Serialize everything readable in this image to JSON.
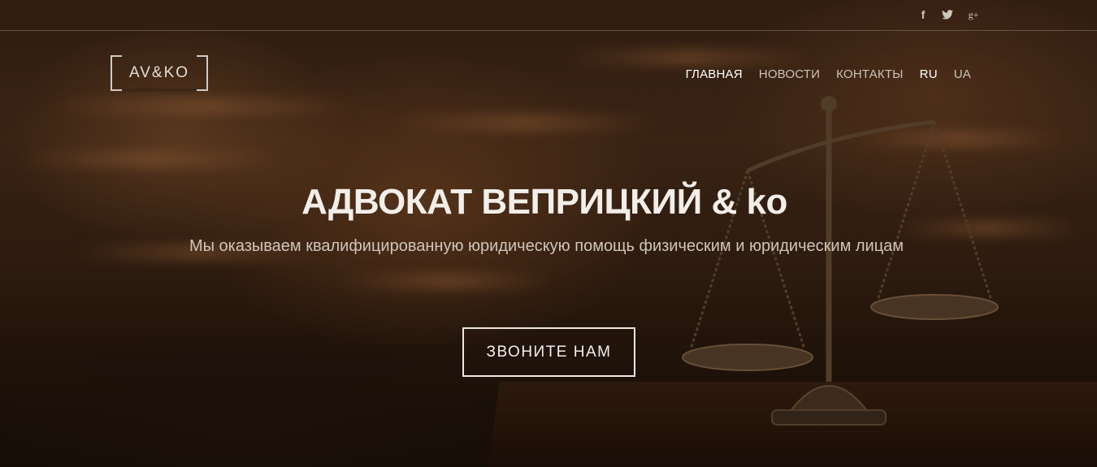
{
  "social": {
    "facebook_icon": "f",
    "twitter_icon": "🐦",
    "googleplus_icon": "g+"
  },
  "logo": {
    "text": "AV&KO"
  },
  "nav": {
    "items": [
      {
        "label": "ГЛАВНАЯ",
        "active": true
      },
      {
        "label": "НОВОСТИ",
        "active": false
      },
      {
        "label": "КОНТАКТЫ",
        "active": false
      }
    ],
    "languages": [
      {
        "label": "RU",
        "active": true
      },
      {
        "label": "UA",
        "active": false
      }
    ]
  },
  "hero": {
    "title": "АДВОКАТ ВЕПРИЦКИЙ & ko",
    "subtitle": "Мы оказываем квалифицированную юридическую помощь физическим и юридическим лицам",
    "cta_label": "ЗВОНИТЕ НАМ"
  },
  "colors": {
    "text_primary": "#f2eeea",
    "nav_text": "#cbc2b9",
    "background_dark": "#1e130b"
  }
}
